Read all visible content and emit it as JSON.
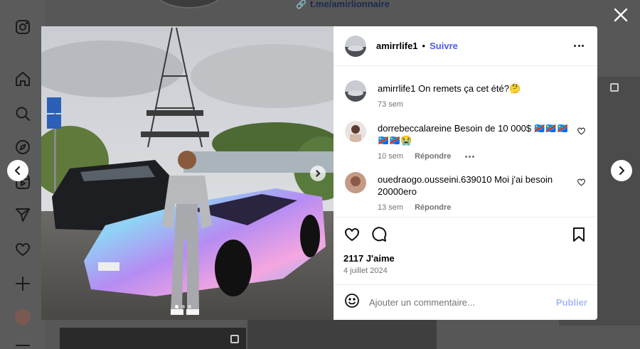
{
  "background": {
    "profile_link": "t.me/amirlionnaire",
    "nav_icons": [
      "instagram-logo-icon",
      "home-icon",
      "search-icon",
      "explore-icon",
      "reels-icon",
      "send-icon",
      "heart-icon",
      "create-icon",
      "profile-avatar-icon",
      "menu-icon"
    ]
  },
  "post": {
    "author": "amirrlife1",
    "separator": "•",
    "follow_label": "Suivre",
    "caption": {
      "user": "amirrlife1",
      "text": "On remets ça cet été?🤔",
      "time": "73 sem"
    },
    "comments": [
      {
        "user": "dorrebeccalareine",
        "text": "Besoin de 10 000$ 🇨🇩🇨🇩🇨🇩🇨🇩🇨🇩😭",
        "time": "10 sem",
        "reply_label": "Répondre"
      },
      {
        "user": "ouedraogo.ousseini.639010",
        "text": "Moi j'ai besoin 20000ero",
        "time": "13 sem",
        "reply_label": "Répondre"
      }
    ],
    "likes": "2117 J'aime",
    "date": "4 juillet 2024",
    "comment_placeholder": "Ajouter un commentaire...",
    "publish_label": "Publier",
    "carousel": {
      "slides": 3,
      "active": 1
    },
    "colors": {
      "follow": "#4a5df0",
      "publish_disabled": "#a8b8f5"
    }
  }
}
